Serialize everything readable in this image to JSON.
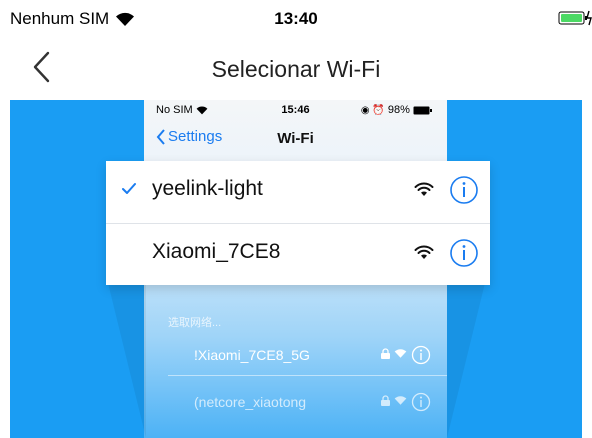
{
  "status_bar": {
    "carrier": "Nenhum SIM",
    "time": "13:40"
  },
  "nav": {
    "title": "Selecionar Wi-Fi"
  },
  "illustration": {
    "phone_status": {
      "carrier": "No SIM",
      "time": "15:46",
      "battery": "98%"
    },
    "phone_nav": {
      "back_label": "Settings",
      "title": "Wi-Fi"
    },
    "section_header": "选取网络...",
    "networks": [
      "!Xiaomi_7CE8_5G",
      "(netcore_xiaotong"
    ],
    "card": {
      "connected_network": "yeelink-light",
      "other_network": "Xiaomi_7CE8"
    }
  },
  "colors": {
    "background_blue": "#1a9df3",
    "accent": "#1a7cf0",
    "battery_green": "#4cd964"
  },
  "icons": [
    "back-chevron-icon",
    "wifi-icon",
    "battery-icon",
    "checkmark-icon",
    "info-icon",
    "lock-icon"
  ]
}
